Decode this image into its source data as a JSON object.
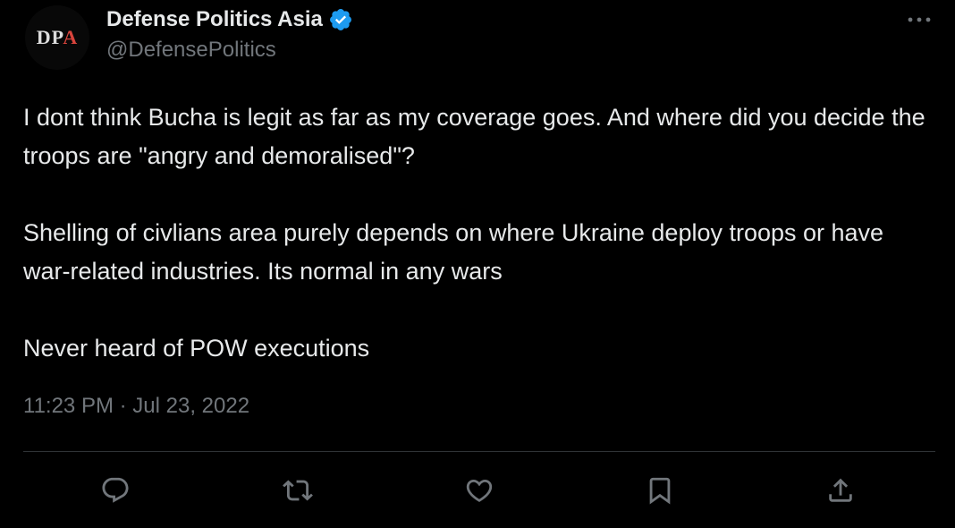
{
  "profile": {
    "display_name": "Defense Politics Asia",
    "handle": "@DefensePolitics",
    "avatar_text": "DPA",
    "verified": true
  },
  "tweet": {
    "paragraphs": [
      "I dont think Bucha is legit as far as my coverage goes. And where did you decide the troops are \"angry and demoralised\"?",
      "Shelling of civlians area purely depends on where Ukraine deploy troops or have war-related industries. Its normal in any wars",
      "Never heard of POW executions"
    ],
    "timestamp": "11:23 PM · Jul 23, 2022"
  },
  "actions": [
    {
      "name": "reply",
      "icon": "reply-icon"
    },
    {
      "name": "retweet",
      "icon": "retweet-icon"
    },
    {
      "name": "like",
      "icon": "heart-icon"
    },
    {
      "name": "bookmark",
      "icon": "bookmark-icon"
    },
    {
      "name": "share",
      "icon": "share-icon"
    }
  ],
  "colors": {
    "background": "#000000",
    "text_primary": "#e7e9ea",
    "text_secondary": "#71767b",
    "verified_blue": "#1d9bf0",
    "divider": "#2f3336"
  }
}
